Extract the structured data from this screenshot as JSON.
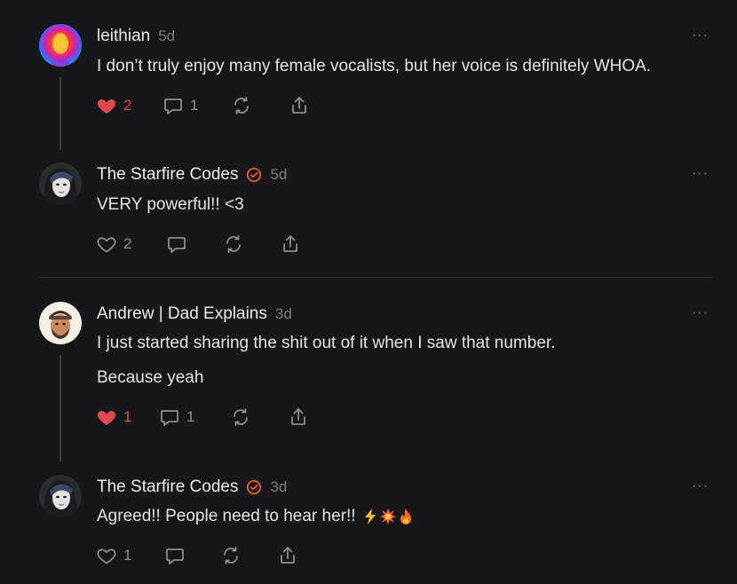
{
  "comments": [
    {
      "author": "leithian",
      "time": "5d",
      "verified": false,
      "lines": [
        "I don’t truly enjoy many female vocalists, but her voice is definitely WHOA."
      ],
      "likes": "2",
      "liked": true,
      "replies": "1",
      "more_label": "···"
    },
    {
      "author": "The Starfire Codes",
      "time": "5d",
      "verified": true,
      "lines": [
        "VERY powerful!! <3"
      ],
      "likes": "2",
      "liked": false,
      "replies": "",
      "more_label": "···"
    },
    {
      "author": "Andrew | Dad Explains",
      "time": "3d",
      "verified": false,
      "lines": [
        "I just started sharing the shit out of it when I saw that number.",
        "Because yeah"
      ],
      "likes": "1",
      "liked": true,
      "replies": "1",
      "more_label": "···"
    },
    {
      "author": "The Starfire Codes",
      "time": "3d",
      "verified": true,
      "lines": [
        "Agreed!! People need to hear her!!"
      ],
      "emoji": "⚡💥🔥",
      "likes": "1",
      "liked": false,
      "replies": "",
      "more_label": "···"
    }
  ],
  "icons": {
    "like": "heart-icon",
    "reply": "comment-bubble-icon",
    "restack": "restack-icon",
    "share": "share-icon",
    "verified": "verified-badge-icon",
    "more": "more-options-icon"
  },
  "colors": {
    "background": "#161719",
    "liked": "#e0484e",
    "verified": "#ff6719",
    "muted": "#7d7e83"
  }
}
